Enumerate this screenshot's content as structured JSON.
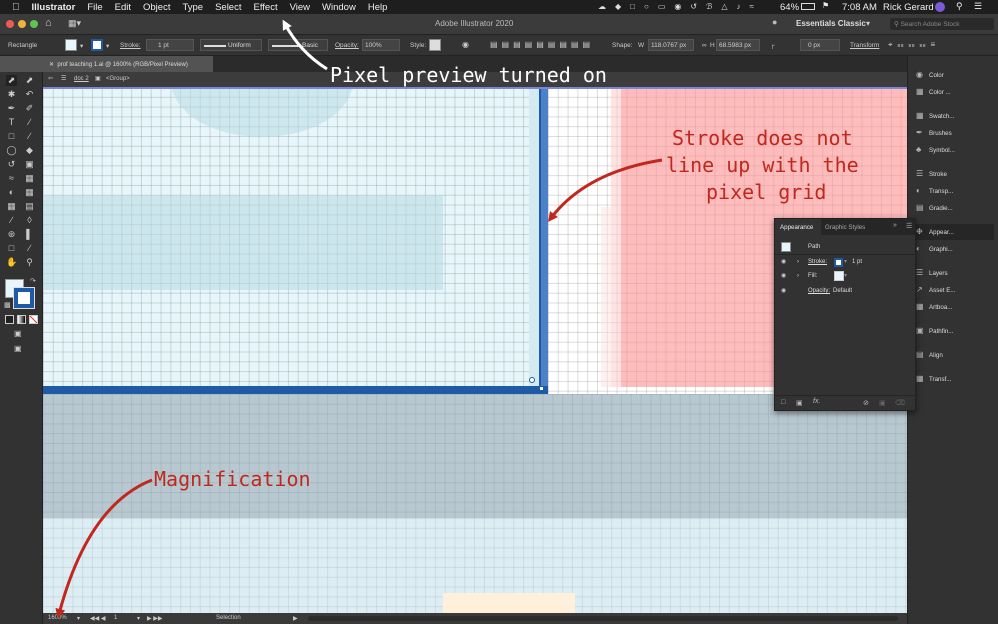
{
  "menubar": {
    "app_name": "Illustrator",
    "items": [
      "File",
      "Edit",
      "Object",
      "Type",
      "Select",
      "Effect",
      "View",
      "Window",
      "Help"
    ],
    "battery": "64%",
    "time": "7:08 AM",
    "user": "Rick Gerard"
  },
  "titlebar": {
    "title": "Adobe Illustrator 2020",
    "workspace": "Essentials Classic",
    "search_placeholder": "Search Adobe Stock"
  },
  "controlbar": {
    "selection_type": "Rectangle",
    "stroke_label": "Stroke:",
    "stroke_value": "1 pt",
    "profile": "Uniform",
    "brush": "Basic",
    "opacity_label": "Opacity:",
    "opacity_value": "100%",
    "style_label": "Style:",
    "shape_label": "Shape:",
    "width_value": "118.0767 px",
    "height_value": "68.5983 px",
    "corner_value": "0 px",
    "transform_label": "Transform"
  },
  "document": {
    "tab_title": "prof teaching 1.ai @ 1600% (RGB/Pixel Preview)",
    "breadcrumb_layer": "doc 2",
    "breadcrumb_group": "<Group>"
  },
  "status": {
    "zoom": "1600%",
    "artboard": "1",
    "mode": "Selection"
  },
  "panels": [
    {
      "label": "Color",
      "icon": "color-icon"
    },
    {
      "label": "Color ...",
      "icon": "color-guide-icon"
    },
    {
      "label": "Swatch...",
      "icon": "swatches-icon"
    },
    {
      "label": "Brushes",
      "icon": "brushes-icon"
    },
    {
      "label": "Symbol...",
      "icon": "symbols-icon"
    },
    {
      "label": "Stroke",
      "icon": "stroke-icon"
    },
    {
      "label": "Transp...",
      "icon": "transparency-icon"
    },
    {
      "label": "Gradie...",
      "icon": "gradient-icon"
    },
    {
      "label": "Appear...",
      "icon": "appearance-icon"
    },
    {
      "label": "Graphi...",
      "icon": "graphic-styles-icon"
    },
    {
      "label": "Layers",
      "icon": "layers-icon"
    },
    {
      "label": "Asset E...",
      "icon": "asset-export-icon"
    },
    {
      "label": "Artboa...",
      "icon": "artboards-icon"
    },
    {
      "label": "Pathfin...",
      "icon": "pathfinder-icon"
    },
    {
      "label": "Align",
      "icon": "align-icon"
    },
    {
      "label": "Transf...",
      "icon": "transform-icon"
    }
  ],
  "appearance_panel": {
    "tab_active": "Appearance",
    "tab_other": "Graphic Styles",
    "object": "Path",
    "stroke_label": "Stroke:",
    "stroke_value": "1 pt",
    "fill_label": "Fill:",
    "opacity_label": "Opacity:",
    "opacity_value": "Default"
  },
  "annotations": {
    "pixel_preview": "Pixel preview turned on",
    "stroke_line1": "Stroke does not",
    "stroke_line2": "line up with the",
    "stroke_line3": "pixel grid",
    "magnification": "Magnification"
  },
  "colors": {
    "annotation_red": "#c0281e",
    "selection_blue": "#1f5aa6",
    "canvas_bg": "#e6f6fa",
    "artwork_pink": "#ffbcbc",
    "artwork_gray": "#b7c8d0"
  }
}
